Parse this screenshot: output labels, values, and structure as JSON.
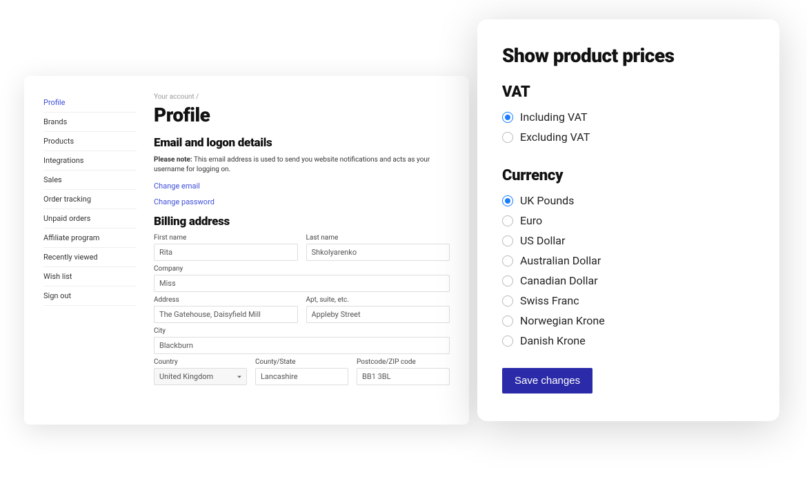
{
  "sidebar": {
    "items": [
      {
        "label": "Profile",
        "active": true
      },
      {
        "label": "Brands"
      },
      {
        "label": "Products"
      },
      {
        "label": "Integrations"
      },
      {
        "label": "Sales"
      },
      {
        "label": "Order tracking"
      },
      {
        "label": "Unpaid orders"
      },
      {
        "label": "Affiliate program"
      },
      {
        "label": "Recently viewed"
      },
      {
        "label": "Wish list"
      },
      {
        "label": "Sign out"
      }
    ]
  },
  "breadcrumb": "Your account  /",
  "page_title": "Profile",
  "email_section": {
    "heading": "Email and logon details",
    "note_bold": "Please note:",
    "note_text": " This email address is used to send you website notifications and acts as your username for logging on.",
    "change_email": "Change email",
    "change_password": "Change password"
  },
  "billing": {
    "heading": "Billing address",
    "labels": {
      "first_name": "First name",
      "last_name": "Last name",
      "company": "Company",
      "address": "Address",
      "apt": "Apt, suite, etc.",
      "city": "City",
      "country": "Country",
      "county": "County/State",
      "postcode": "Postcode/ZIP code"
    },
    "values": {
      "first_name": "Rita",
      "last_name": "Shkolyarenko",
      "company": "Miss",
      "address": "The Gatehouse, Daisyfield Mill",
      "apt": "Appleby Street",
      "city": "Blackburn",
      "country": "United Kingdom",
      "county": "Lancashire",
      "postcode": "BB1 3BL"
    }
  },
  "prices": {
    "title": "Show product prices",
    "vat": {
      "heading": "VAT",
      "options": [
        {
          "label": "Including VAT",
          "checked": true
        },
        {
          "label": "Excluding VAT",
          "checked": false
        }
      ]
    },
    "currency": {
      "heading": "Currency",
      "options": [
        {
          "label": "UK Pounds",
          "checked": true
        },
        {
          "label": "Euro",
          "checked": false
        },
        {
          "label": "US Dollar",
          "checked": false
        },
        {
          "label": "Australian Dollar",
          "checked": false
        },
        {
          "label": "Canadian Dollar",
          "checked": false
        },
        {
          "label": "Swiss Franc",
          "checked": false
        },
        {
          "label": "Norwegian Krone",
          "checked": false
        },
        {
          "label": "Danish Krone",
          "checked": false
        }
      ]
    },
    "save_button": "Save changes"
  }
}
